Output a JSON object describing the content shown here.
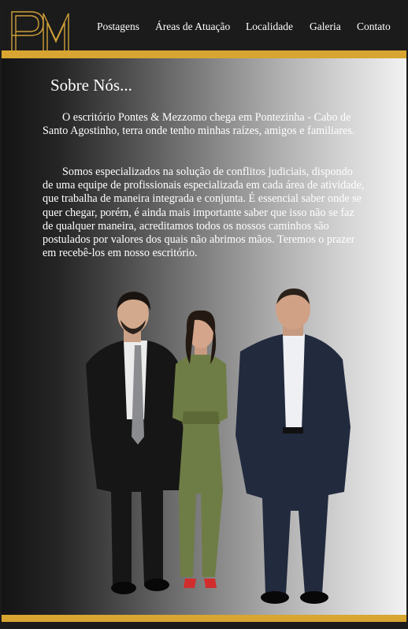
{
  "brand": {
    "logo_icon": "pm-monogram-logo",
    "logo_letters": "PM",
    "accent_color": "#d9a531",
    "header_color": "#1b1b1b"
  },
  "nav": {
    "items": [
      {
        "label": "Postagens"
      },
      {
        "label": "Áreas de Atuação"
      },
      {
        "label": "Localidade"
      },
      {
        "label": "Galeria"
      },
      {
        "label": "Contato"
      }
    ]
  },
  "about": {
    "title": "Sobre Nós...",
    "paragraphs": [
      "O escritório Pontes & Mezzomo chega em Pontezinha - Cabo de Santo Agostinho, terra onde tenho minhas raízes, amigos e familiares.",
      "Somos especializados na solução de conflitos judiciais, dispondo de uma equipe de profissionais especializada em cada área de atividade, que trabalha de maneira integrada e conjunta. É essencial saber onde se quer chegar, porém, é ainda mais importante saber que isso não se faz de qualquer maneira, acreditamos todos os nossos caminhos são postulados por valores dos quais não abrimos mãos. Teremos o prazer em recebê-los em nosso escritório."
    ]
  },
  "team_photo": {
    "icon": "team-group-photo"
  }
}
